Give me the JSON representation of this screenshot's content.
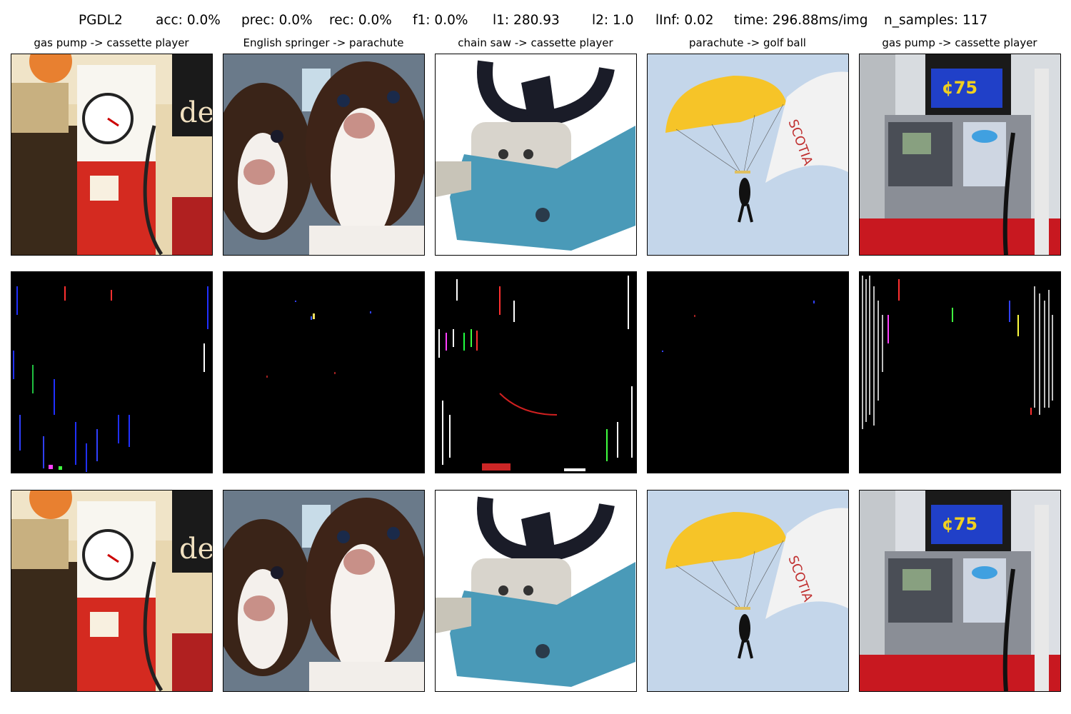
{
  "header": {
    "method": "PGDL2",
    "metrics": [
      {
        "label": "acc:",
        "value": "0.0%"
      },
      {
        "label": "prec:",
        "value": "0.0%"
      },
      {
        "label": "rec:",
        "value": "0.0%"
      },
      {
        "label": "f1:",
        "value": "0.0%"
      },
      {
        "label": "l1:",
        "value": "280.93"
      },
      {
        "label": "l2:",
        "value": "1.0"
      },
      {
        "label": "lInf:",
        "value": "0.02"
      },
      {
        "label": "time:",
        "value": "296.88ms/img"
      },
      {
        "label": "n_samples:",
        "value": "117"
      }
    ]
  },
  "columns": [
    {
      "title": "gas pump -> cassette player"
    },
    {
      "title": "English springer -> parachute"
    },
    {
      "title": "chain saw -> cassette player"
    },
    {
      "title": "parachute -> golf ball"
    },
    {
      "title": "gas pump -> cassette player"
    }
  ],
  "colors": {
    "background": "#ffffff",
    "perturbation_bg": "#000000",
    "border": "#000000"
  }
}
